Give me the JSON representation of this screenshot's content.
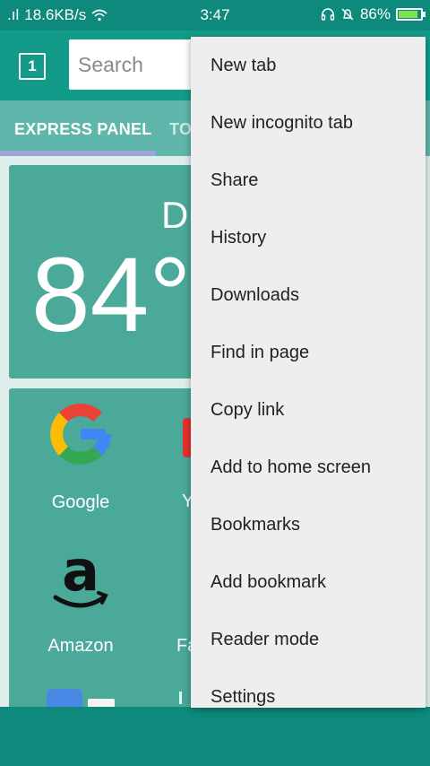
{
  "status_bar": {
    "signal": ".ıl",
    "net_speed": "18.6KB/s",
    "time": "3:47",
    "battery_percent": "86%",
    "battery_level": 0.86
  },
  "toolbar": {
    "tab_count": "1",
    "search_placeholder": "Search"
  },
  "tabs": [
    {
      "label": "EXPRESS PANEL"
    },
    {
      "label": "TO"
    }
  ],
  "weather": {
    "day_partial": "D",
    "temperature": "84°"
  },
  "speed_dial": [
    {
      "label": "Google"
    },
    {
      "label": "Amazon"
    }
  ],
  "peeking_labels": [
    "Y",
    "Fa"
  ],
  "menu": {
    "items": [
      {
        "label": "New tab"
      },
      {
        "label": "New incognito tab"
      },
      {
        "label": "Share"
      },
      {
        "label": "History"
      },
      {
        "label": "Downloads"
      },
      {
        "label": "Find in page"
      },
      {
        "label": "Copy link"
      },
      {
        "label": "Add to home screen"
      },
      {
        "label": "Bookmarks"
      },
      {
        "label": "Add bookmark"
      },
      {
        "label": "Reader mode"
      },
      {
        "label": "Settings"
      }
    ]
  },
  "colors": {
    "status_bar": "#0d8a7b",
    "toolbar": "#139b8a",
    "tile": "#4aa999",
    "menu_bg": "#eeeeee"
  }
}
